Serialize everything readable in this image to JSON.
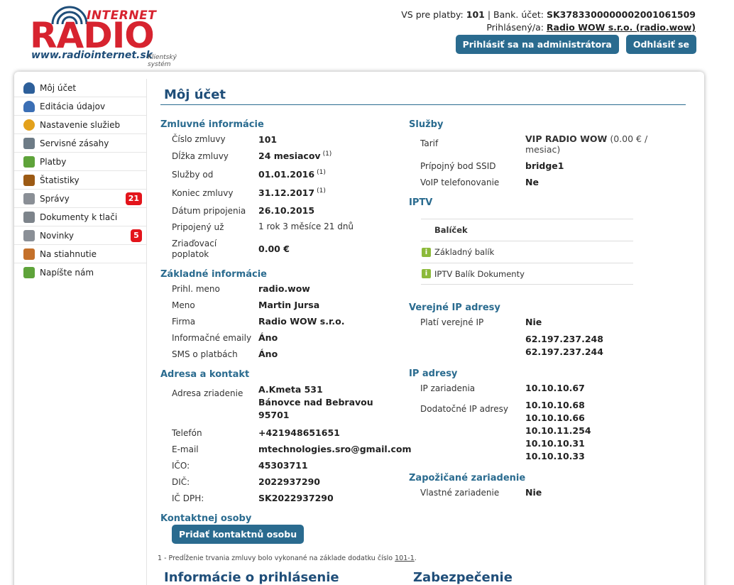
{
  "logo": {
    "internet": "INTERNET",
    "radio": "RADIO",
    "url": "www.radiointernet.sk",
    "subtitle": "Klientský systém"
  },
  "header": {
    "vs_label": "VS pre platby:",
    "vs_value": "101",
    "bank_label": "Bank. účet:",
    "bank_value": "SK3783300000002001061509",
    "login_label": "Prihlásený/a:",
    "login_value": "Radio WOW s.r.o. (radio.wow)",
    "admin_button": "Prihlásiť sa na administrátora",
    "logout_button": "Odhlásiť se"
  },
  "sidebar": {
    "items": [
      {
        "label": "Môj účet",
        "icon": "user-icon",
        "color": "#2d5f9a"
      },
      {
        "label": "Editácia údajov",
        "icon": "users-edit-icon",
        "color": "#3b6fb5"
      },
      {
        "label": "Nastavenie služieb",
        "icon": "gear-icon",
        "color": "#e3a11b"
      },
      {
        "label": "Servisné zásahy",
        "icon": "tools-icon",
        "color": "#6d7b86"
      },
      {
        "label": "Platby",
        "icon": "money-icon",
        "color": "#5ea33a"
      },
      {
        "label": "Štatistiky",
        "icon": "chart-icon",
        "color": "#9c5a14"
      },
      {
        "label": "Správy",
        "icon": "mail-icon",
        "color": "#8a8f96",
        "badge": "21"
      },
      {
        "label": "Dokumenty k tlači",
        "icon": "printer-icon",
        "color": "#7d848b"
      },
      {
        "label": "Novinky",
        "icon": "newspaper-icon",
        "color": "#8a8f96",
        "badge": "5"
      },
      {
        "label": "Na stiahnutie",
        "icon": "download-icon",
        "color": "#c4702a"
      },
      {
        "label": "Napíšte nám",
        "icon": "mail-add-icon",
        "color": "#5ea33a"
      }
    ]
  },
  "main": {
    "title": "Môj účet",
    "contract": {
      "heading": "Zmluvné informácie",
      "rows": [
        {
          "label": "Číslo zmluvy",
          "value": "101",
          "note": ""
        },
        {
          "label": "Dĺžka zmluvy",
          "value": "24 mesiacov",
          "note": "(1)"
        },
        {
          "label": "Služby od",
          "value": "01.01.2016",
          "note": "(1)"
        },
        {
          "label": "Koniec zmluvy",
          "value": "31.12.2017",
          "note": "(1)"
        },
        {
          "label": "Dátum pripojenia",
          "value": "26.10.2015",
          "note": ""
        },
        {
          "label": "Pripojený už",
          "value": "1 rok 3 měsíce 21 dnů",
          "note": ""
        }
      ],
      "fee_label_1": "Zriaďovací",
      "fee_label_2": "poplatok",
      "fee_value": "0.00 €"
    },
    "basic": {
      "heading": "Základné informácie",
      "rows": [
        {
          "label": "Prihl. meno",
          "value": "radio.wow"
        },
        {
          "label": "Meno",
          "value": "Martin Jursa"
        },
        {
          "label": "Firma",
          "value": "Radio WOW s.r.o."
        },
        {
          "label": "Informačné emaily",
          "value": "Áno"
        },
        {
          "label": "SMS o platbách",
          "value": "Áno"
        }
      ]
    },
    "address": {
      "heading": "Adresa a kontakt",
      "addr_label": "Adresa zriadenie",
      "addr_line1": "A.Kmeta 531",
      "addr_line2": "Bánovce nad Bebravou",
      "addr_line3": "95701",
      "rows": [
        {
          "label": "Telefón",
          "value": "+421948651651"
        },
        {
          "label": "E-mail",
          "value": "mtechnologies.sro@gmail.com"
        },
        {
          "label": "IČO:",
          "value": "45303711"
        },
        {
          "label": "DIČ:",
          "value": "2022937290"
        },
        {
          "label": "IČ DPH:",
          "value": "SK2022937290"
        }
      ]
    },
    "contact": {
      "heading": "Kontaktnej osoby",
      "add_button": "Pridať kontaktnů osobu"
    },
    "services": {
      "heading": "Služby",
      "tariff_label": "Tarif",
      "tariff_value": "VIP RADIO WOW",
      "tariff_price": "(0.00 € /",
      "tariff_unit": "mesiac)",
      "ssid_label": "Prípojný bod SSID",
      "ssid_value": "bridge1",
      "voip_label": "VoIP telefonovanie",
      "voip_value": "Ne"
    },
    "iptv": {
      "heading": "IPTV",
      "table_header": "Balíček",
      "packages": [
        "Základný balík",
        "IPTV Balík Dokumenty"
      ]
    },
    "public_ip": {
      "heading": "Verejné IP adresy",
      "label": "Platí verejné IP",
      "value": "Nie",
      "addresses": [
        "62.197.237.248",
        "62.197.237.244"
      ]
    },
    "ip": {
      "heading": "IP adresy",
      "device_label": "IP zariadenia",
      "device_value": "10.10.10.67",
      "extra_label": "Dodatočné IP adresy",
      "extra_values": [
        "10.10.10.68",
        "10.10.10.66",
        "10.10.11.254",
        "10.10.10.31",
        "10.10.10.33"
      ]
    },
    "borrowed": {
      "heading": "Zapožičané zariadenie",
      "label": "Vlastné zariadenie",
      "value": "Nie"
    },
    "footnote_text": "1 - Predĺženie trvania zmluvy bolo vykonané na základe dodatku číslo",
    "footnote_link": "101-1",
    "footnote_end": ".",
    "bottom_left": "Informácie o prihlásenie",
    "bottom_right": "Zabezpečenie"
  }
}
